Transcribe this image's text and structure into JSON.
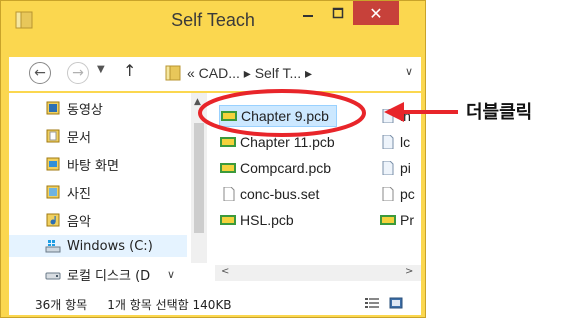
{
  "window": {
    "title": "Self Teach",
    "close_glyph": "✕",
    "accent": "#fbd74f"
  },
  "nav": {
    "back_icon": "back-arrow-icon",
    "forward_icon": "forward-arrow-icon",
    "up_icon": "up-arrow-icon",
    "address_text": "« CAD... ▸ Self T... ▸"
  },
  "sidebar": {
    "items": [
      {
        "label": "동영상",
        "icon": "video-library-icon"
      },
      {
        "label": "문서",
        "icon": "documents-library-icon"
      },
      {
        "label": "바탕 화면",
        "icon": "desktop-icon"
      },
      {
        "label": "사진",
        "icon": "pictures-library-icon"
      },
      {
        "label": "음악",
        "icon": "music-library-icon"
      },
      {
        "label": "Windows (C:)",
        "icon": "system-drive-icon"
      },
      {
        "label": "로컬 디스크 (D",
        "icon": "local-disk-icon"
      }
    ]
  },
  "files": {
    "col1": [
      "Chapter 9.pcb",
      "Chapter 11.pcb",
      "Compcard.pcb",
      "conc-bus.set",
      "HSL.pcb"
    ],
    "col2": [
      "ln",
      "lc",
      "pi",
      "pc",
      "Pr"
    ]
  },
  "status": {
    "item_count": "36개 항목",
    "selection": "1개 항목 선택함 140KB"
  },
  "annotation": {
    "label": "더블클릭",
    "color": "#e8252a"
  }
}
